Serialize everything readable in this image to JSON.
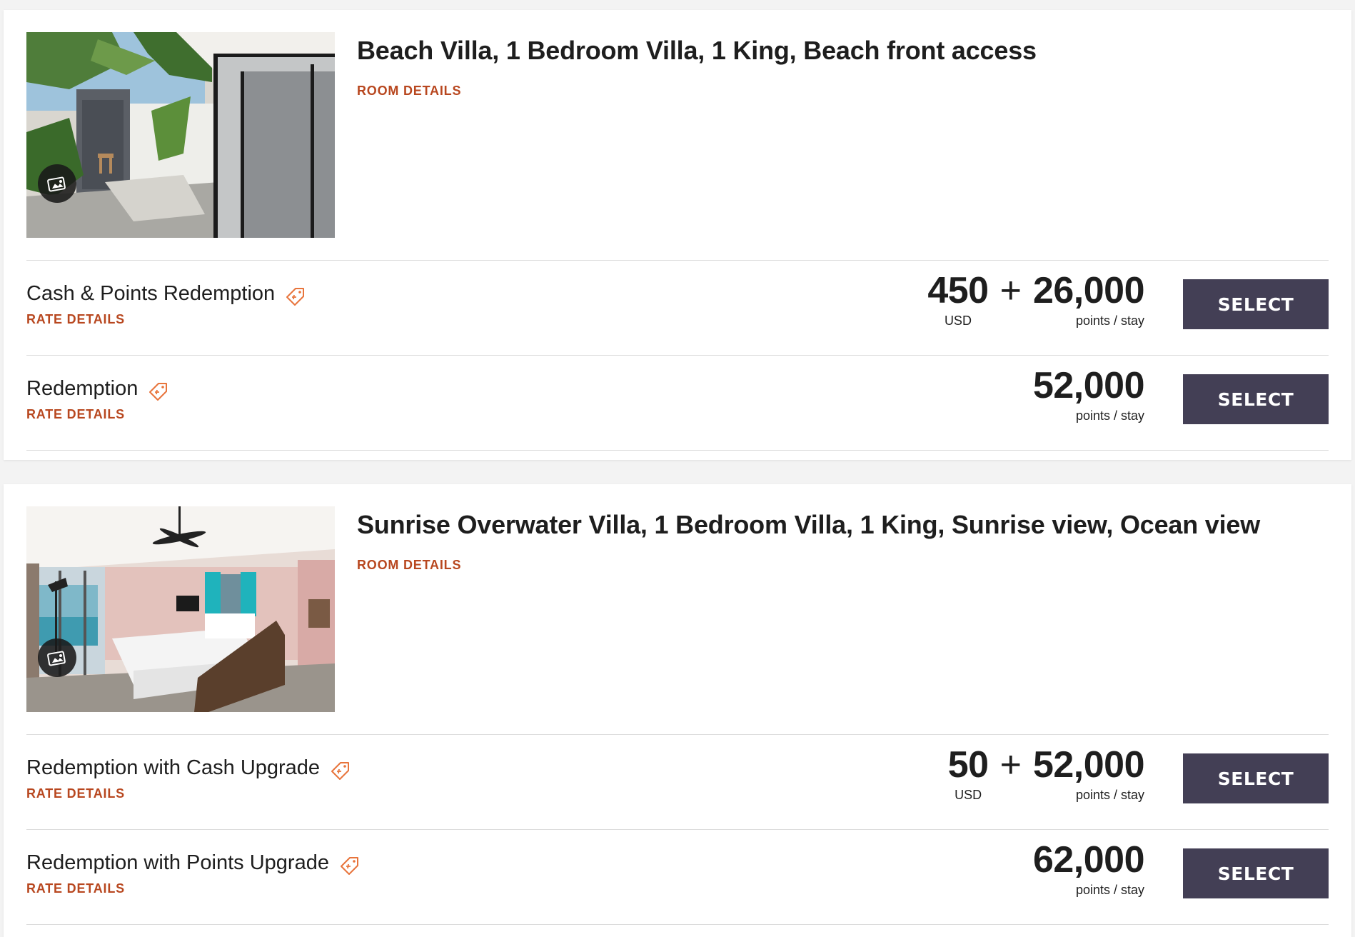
{
  "rooms": [
    {
      "title": "Beach Villa, 1 Bedroom Villa, 1 King, Beach front access",
      "details_link": "ROOM DETAILS",
      "photo_icon": "gallery-icon",
      "rates": [
        {
          "name": "Cash & Points Redemption",
          "details_link": "RATE DETAILS",
          "cash": "450",
          "cash_unit": "USD",
          "plus": "+",
          "points": "26,000",
          "points_unit": "points / stay",
          "button": "SELECT"
        },
        {
          "name": "Redemption",
          "details_link": "RATE DETAILS",
          "points": "52,000",
          "points_unit": "points / stay",
          "button": "SELECT"
        }
      ]
    },
    {
      "title": "Sunrise Overwater Villa, 1 Bedroom Villa, 1 King, Sunrise view, Ocean view",
      "details_link": "ROOM DETAILS",
      "photo_icon": "gallery-icon",
      "rates": [
        {
          "name": "Redemption with Cash Upgrade",
          "details_link": "RATE DETAILS",
          "cash": "50",
          "cash_unit": "USD",
          "plus": "+",
          "points": "52,000",
          "points_unit": "points / stay",
          "button": "SELECT"
        },
        {
          "name": "Redemption with Points Upgrade",
          "details_link": "RATE DETAILS",
          "points": "62,000",
          "points_unit": "points / stay",
          "button": "SELECT"
        }
      ]
    }
  ],
  "colors": {
    "accent": "#b8471f",
    "button_bg": "#433f55",
    "tag_icon": "#e8743b"
  }
}
